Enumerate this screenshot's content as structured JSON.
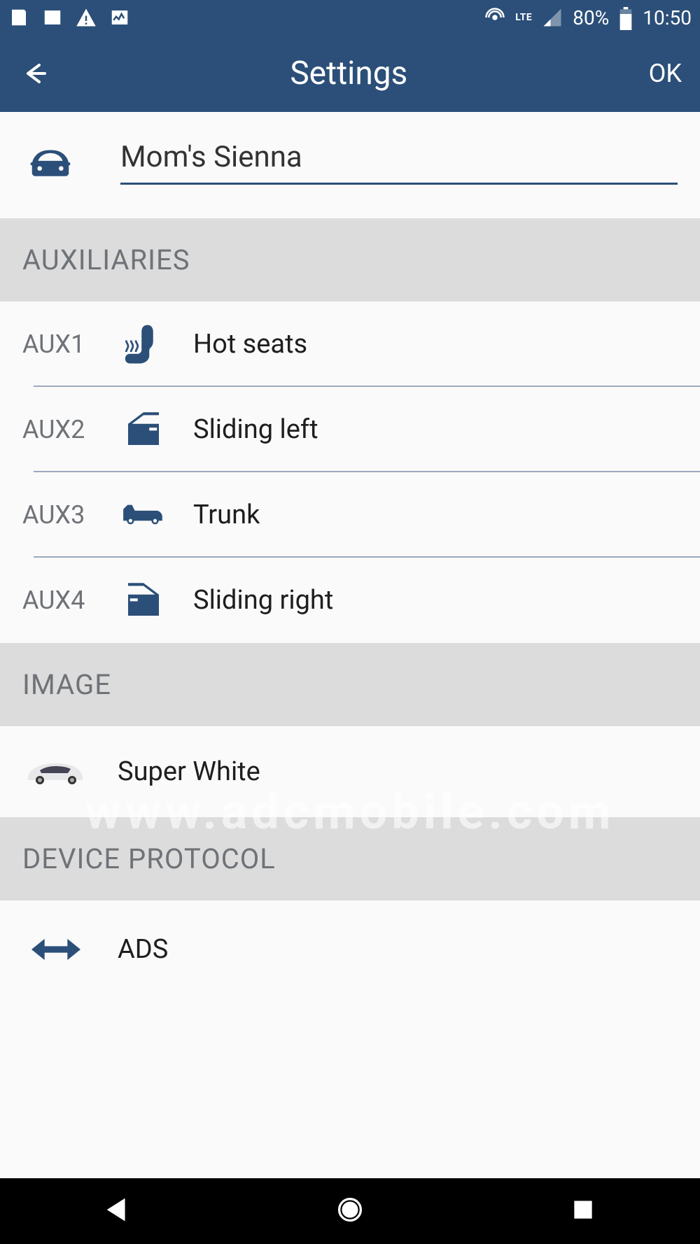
{
  "status": {
    "network": "LTE",
    "battery": "80%",
    "time": "10:50"
  },
  "header": {
    "title": "Settings",
    "ok": "OK"
  },
  "vehicle": {
    "name": "Mom's Sienna"
  },
  "sections": {
    "aux_header": "AUXILIARIES",
    "image_header": "IMAGE",
    "protocol_header": "DEVICE PROTOCOL"
  },
  "aux": [
    {
      "label": "AUX1",
      "value": "Hot seats",
      "icon": "heated-seat-icon"
    },
    {
      "label": "AUX2",
      "value": "Sliding left",
      "icon": "door-left-icon"
    },
    {
      "label": "AUX3",
      "value": "Trunk",
      "icon": "car-trunk-icon"
    },
    {
      "label": "AUX4",
      "value": "Sliding right",
      "icon": "door-right-icon"
    }
  ],
  "image": {
    "label": "Super White"
  },
  "protocol": {
    "label": "ADS"
  },
  "watermark": "www.adcmobile.com"
}
